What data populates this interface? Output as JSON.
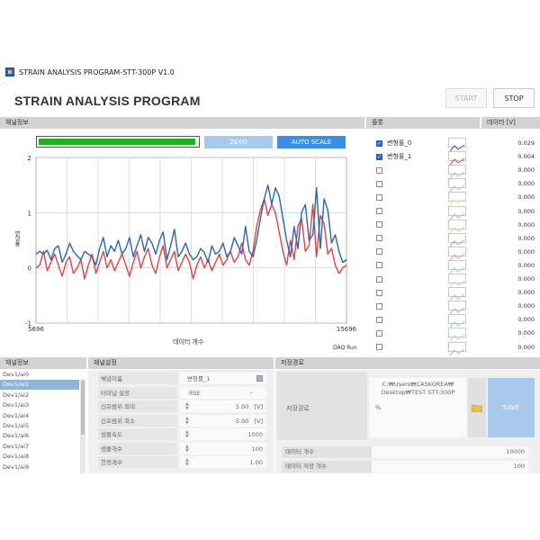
{
  "window": {
    "title": "STRAIN ANALYSIS PROGRAM-STT-300P V1.0"
  },
  "header": {
    "app_title": "STRAIN ANALYSIS PROGRAM",
    "start_label": "START",
    "stop_label": "STOP"
  },
  "sections": {
    "channel_info": "채널정보",
    "plot": "플롯",
    "data": "데이터 [V]",
    "channel_info_bottom": "채널정보",
    "channel_settings": "채널설정",
    "save_path": "저장경로"
  },
  "chart_controls": {
    "zero_label": "ZERO",
    "auto_scale_label": "AUTO SCALE",
    "progress_fraction": 0.99,
    "daq_label": "DAQ Run"
  },
  "chart_data": {
    "type": "line",
    "xlabel": "데이터 개수",
    "ylabel": "변형률",
    "xlim": [
      5696,
      15696
    ],
    "ylim": [
      -1,
      2
    ],
    "x_tick_labels": [
      "5696",
      "15696"
    ],
    "y_tick_labels": [
      "2",
      "1",
      "0",
      "-1"
    ],
    "series": [
      {
        "color": "#2a63b8",
        "values": [
          0.25,
          0.3,
          0.25,
          0.32,
          0.15,
          0.35,
          0.4,
          0.1,
          0.25,
          0.45,
          0.3,
          0.22,
          0.15,
          0.3,
          0.25,
          0.2,
          0.05,
          0.35,
          0.55,
          0.2,
          0.4,
          0.3,
          0.5,
          0.25,
          0.35,
          0.55,
          0.2,
          0.4,
          0.6,
          0.3,
          0.55,
          0.45,
          0.25,
          0.5,
          0.65,
          0.15,
          0.4,
          0.7,
          0.2,
          0.3,
          0.45,
          0.25,
          0.15,
          0.2,
          0.35,
          0.28,
          0.1,
          0.4,
          0.25,
          0.3,
          0.45,
          0.2,
          0.3,
          0.55,
          0.4,
          0.25,
          0.75,
          0.3,
          0.2,
          0.5,
          0.9,
          1.25,
          1.5,
          1.15,
          1.45,
          1.3,
          0.9,
          0.5,
          0.2,
          0.75,
          0.35,
          1.0,
          1.15,
          0.5,
          0.6,
          1.45,
          0.35,
          1.25,
          1.05,
          0.45,
          0.6,
          0.3,
          0.1,
          0.15
        ]
      },
      {
        "color": "#e84040",
        "values": [
          0.0,
          0.05,
          0.3,
          -0.05,
          0.1,
          0.25,
          0.05,
          -0.15,
          0.1,
          0.2,
          -0.1,
          0.0,
          0.15,
          -0.2,
          0.05,
          0.25,
          -0.1,
          0.1,
          0.3,
          0.0,
          0.15,
          -0.05,
          0.1,
          0.25,
          0.05,
          -0.15,
          0.1,
          0.3,
          0.0,
          0.2,
          0.35,
          0.05,
          -0.1,
          0.2,
          0.4,
          0.0,
          0.15,
          0.3,
          -0.05,
          0.1,
          0.25,
          0.1,
          -0.2,
          0.05,
          0.2,
          0.0,
          0.15,
          -0.05,
          0.1,
          0.25,
          0.05,
          0.15,
          0.3,
          0.1,
          0.2,
          0.45,
          0.15,
          0.05,
          0.3,
          0.75,
          1.05,
          1.25,
          0.95,
          1.15,
          1.0,
          0.65,
          0.3,
          0.05,
          0.5,
          0.15,
          0.75,
          0.9,
          0.3,
          0.4,
          1.15,
          0.2,
          0.95,
          0.8,
          0.25,
          0.35,
          0.05,
          -0.1,
          0.0,
          0.05
        ]
      }
    ]
  },
  "plot_legend": {
    "items": [
      {
        "label": "변형률_0",
        "checked": true,
        "color": "#2a63b8"
      },
      {
        "label": "변형률_1",
        "checked": true,
        "color": "#e84040"
      },
      {
        "label": "",
        "checked": false,
        "color": "#9ed69e"
      },
      {
        "label": "",
        "checked": false,
        "color": "#9ec6e6"
      },
      {
        "label": "",
        "checked": false,
        "color": "#e6e69e"
      },
      {
        "label": "",
        "checked": false,
        "color": "#d6a0d6"
      },
      {
        "label": "",
        "checked": false,
        "color": "#d6d69e"
      },
      {
        "label": "",
        "checked": false,
        "color": "#a0a0d6"
      },
      {
        "label": "",
        "checked": false,
        "color": "#e6a0a0"
      },
      {
        "label": "",
        "checked": false,
        "color": "#a0d6a0"
      },
      {
        "label": "",
        "checked": false,
        "color": "#d0d0d0"
      },
      {
        "label": "",
        "checked": false,
        "color": "#e6a0c6"
      },
      {
        "label": "",
        "checked": false,
        "color": "#a0c6a0"
      },
      {
        "label": "",
        "checked": false,
        "color": "#a0c6e6"
      },
      {
        "label": "",
        "checked": false,
        "color": "#c6c6e6"
      },
      {
        "label": "",
        "checked": false,
        "color": "#d6a0d6"
      }
    ]
  },
  "data_values": [
    "0.029",
    "0.004",
    "0.000",
    "0.000",
    "0.000",
    "0.000",
    "0.000",
    "0.000",
    "0.000",
    "0.000",
    "0.000",
    "0.000",
    "0.000",
    "0.000",
    "0.000",
    "0.000"
  ],
  "channels": [
    "Dev1/ai0",
    "Dev1/ai1",
    "Dev1/ai2",
    "Dev1/ai3",
    "Dev1/ai4",
    "Dev1/ai5",
    "Dev1/ai6",
    "Dev1/ai7",
    "Dev1/ai8",
    "Dev1/ai9"
  ],
  "selected_channel_index": 1,
  "channel_settings": {
    "rows": [
      {
        "label": "채널이름",
        "value": "변형률_1"
      },
      {
        "label": "터미널 설정",
        "value": "RSE"
      },
      {
        "label": "신호범위 최대",
        "value": "5.00",
        "unit": "[V]"
      },
      {
        "label": "신호범위 최소",
        "value": "-5.00",
        "unit": "[V]"
      },
      {
        "label": "샘플속도",
        "value": "1000"
      },
      {
        "label": "샘플개수",
        "value": "100"
      },
      {
        "label": "한정계수",
        "value": "1.00"
      }
    ]
  },
  "save": {
    "path_label": "저장경로",
    "path_value": "C:\\Users\\CASKOREA\\Desktop\\TEST STT-300P",
    "path_display_line1": "C:₩Users₩CASKOREA₩",
    "path_display_line2": "Desktop₩TEST STT-300P",
    "percent_mark": "%",
    "save_label": "SAVE",
    "data_count_label": "데이터 개수",
    "data_count_value": "10000",
    "data_save_count_label": "데이터 저장 개수",
    "data_save_count_value": "100"
  }
}
